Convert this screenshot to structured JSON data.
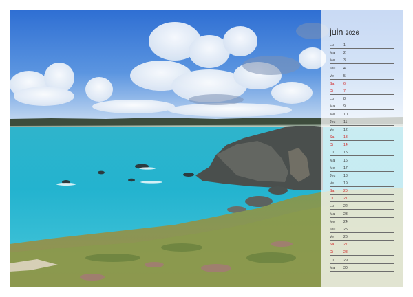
{
  "calendar": {
    "month": "juin",
    "year": "2026",
    "days": [
      {
        "d": "Lu",
        "n": "1"
      },
      {
        "d": "Ma",
        "n": "2"
      },
      {
        "d": "Me",
        "n": "3"
      },
      {
        "d": "Jeu",
        "n": "4"
      },
      {
        "d": "Ve",
        "n": "5"
      },
      {
        "d": "Sa",
        "n": "6",
        "we": true
      },
      {
        "d": "Di",
        "n": "7",
        "we": true
      },
      {
        "d": "Lu",
        "n": "8"
      },
      {
        "d": "Ma",
        "n": "9"
      },
      {
        "d": "Me",
        "n": "10"
      },
      {
        "d": "Jeu",
        "n": "11"
      },
      {
        "d": "Ve",
        "n": "12"
      },
      {
        "d": "Sa",
        "n": "13",
        "we": true
      },
      {
        "d": "Di",
        "n": "14",
        "we": true
      },
      {
        "d": "Lu",
        "n": "15"
      },
      {
        "d": "Ma",
        "n": "16"
      },
      {
        "d": "Me",
        "n": "17"
      },
      {
        "d": "Jeu",
        "n": "18"
      },
      {
        "d": "Ve",
        "n": "19"
      },
      {
        "d": "Sa",
        "n": "20",
        "we": true
      },
      {
        "d": "Di",
        "n": "21",
        "we": true
      },
      {
        "d": "Lu",
        "n": "22"
      },
      {
        "d": "Ma",
        "n": "23"
      },
      {
        "d": "Me",
        "n": "24"
      },
      {
        "d": "Jeu",
        "n": "25"
      },
      {
        "d": "Ve",
        "n": "26"
      },
      {
        "d": "Sa",
        "n": "27",
        "we": true
      },
      {
        "d": "Di",
        "n": "28",
        "we": true
      },
      {
        "d": "Lu",
        "n": "29"
      },
      {
        "d": "Ma",
        "n": "30"
      }
    ]
  },
  "colors": {
    "weekend": "#d22a2a",
    "weekday": "#3a3a3a",
    "sea": "#27b8cf",
    "sky": "#3d7fd6"
  }
}
